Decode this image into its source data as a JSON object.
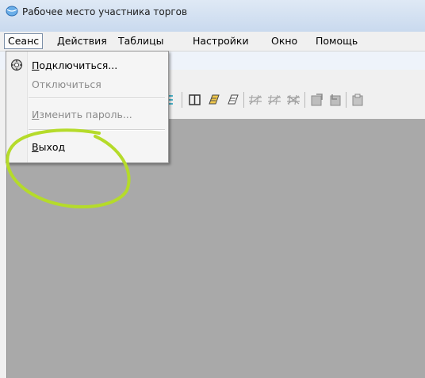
{
  "window": {
    "title": "Рабочее место участника торгов",
    "icon": "app-globe-icon"
  },
  "menubar": {
    "items": [
      {
        "label": "Сеанс",
        "open": true
      },
      {
        "label": "Действия"
      },
      {
        "label": "Таблицы"
      },
      {
        "label": "Настройки"
      },
      {
        "label": "Окно"
      },
      {
        "label": "Помощь"
      }
    ]
  },
  "session_menu": {
    "connect": {
      "first": "П",
      "rest": "одключиться...",
      "enabled": true,
      "icon": "connect-gear-icon"
    },
    "disconnect": {
      "label": "Отключиться",
      "enabled": false
    },
    "change_password": {
      "first": "И",
      "rest": "зменить пароль...",
      "enabled": false
    },
    "exit": {
      "first": "В",
      "rest": "ыход",
      "enabled": true
    }
  },
  "colors": {
    "highlight": "#b5db2a",
    "workspace": "#a9a9a9",
    "menu_border": "#7c8fa8"
  }
}
